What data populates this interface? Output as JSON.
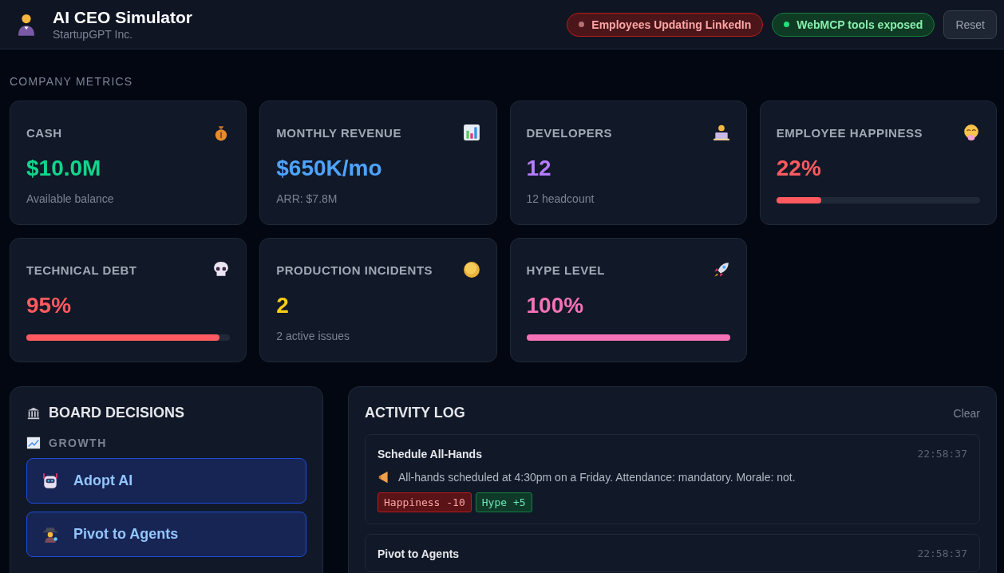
{
  "header": {
    "title": "AI CEO Simulator",
    "subtitle": "StartupGPT Inc.",
    "statuses": [
      {
        "label": "Employees Updating LinkedIn",
        "kind": "danger"
      },
      {
        "label": "WebMCP tools exposed",
        "kind": "success"
      }
    ],
    "reset_button": "Reset"
  },
  "metrics_heading": "COMPANY METRICS",
  "metrics": [
    {
      "label": "CASH",
      "value": "$10.0M",
      "color": "#10d68c",
      "kind": "text",
      "note": "Available balance"
    },
    {
      "label": "MONTHLY REVENUE",
      "value": "$650K/mo",
      "color": "#4da3ff",
      "kind": "text",
      "note": "ARR: $7.8M"
    },
    {
      "label": "DEVELOPERS",
      "value": "12",
      "color": "#b57cff",
      "kind": "text",
      "note": "12 headcount"
    },
    {
      "label": "EMPLOYEE HAPPINESS",
      "value": "22%",
      "color": "#ff5a5f",
      "kind": "bar",
      "level": 0.22
    },
    {
      "label": "TECHNICAL DEBT",
      "value": "95%",
      "color": "#ff5a5f",
      "kind": "bar",
      "level": 0.95
    },
    {
      "label": "PRODUCTION INCIDENTS",
      "value": "2",
      "color": "#facc15",
      "kind": "text",
      "note": "2 active issues"
    },
    {
      "label": "HYPE LEVEL",
      "value": "100%",
      "color": "#f472b6",
      "kind": "bar",
      "level": 1.0
    }
  ],
  "board": {
    "title": "BOARD DECISIONS",
    "group": "GROWTH",
    "decisions": [
      {
        "label": "Adopt AI"
      },
      {
        "label": "Pivot to Agents"
      }
    ]
  },
  "log": {
    "title": "ACTIVITY LOG",
    "clear": "Clear",
    "entries": [
      {
        "title": "Schedule All-Hands",
        "time": "22:58:37",
        "message": "All-hands scheduled at 4:30pm on a Friday. Attendance: mandatory. Morale: not.",
        "tags": [
          {
            "label": "Happiness -10",
            "kind": "negative"
          },
          {
            "label": "Hype +5",
            "kind": "positive"
          }
        ]
      },
      {
        "title": "Pivot to Agents",
        "time": "22:58:37"
      }
    ]
  }
}
